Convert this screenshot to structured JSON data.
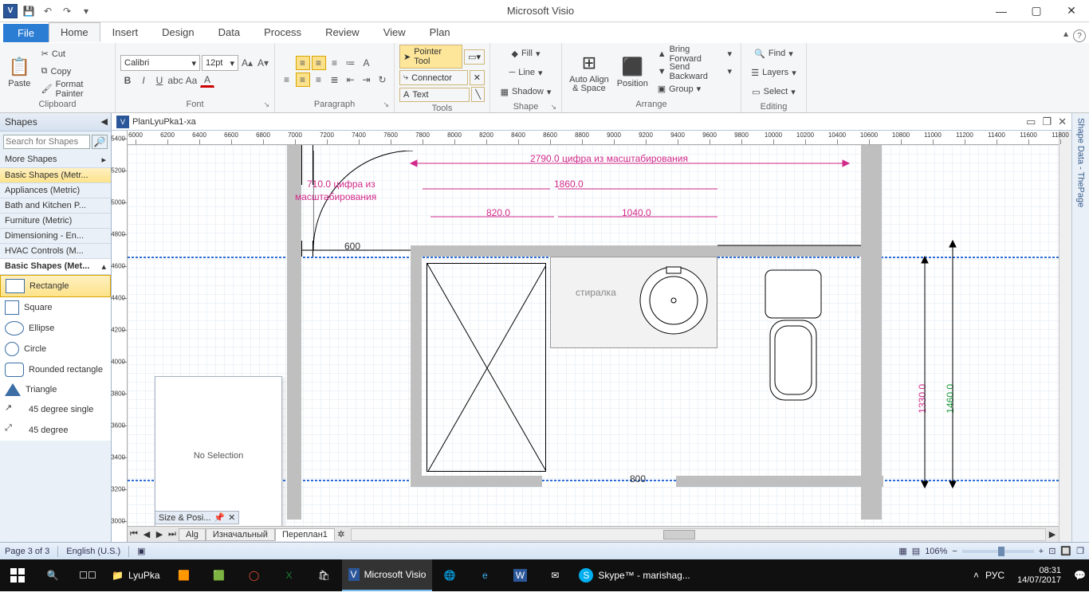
{
  "titlebar": {
    "app_title": "Microsoft Visio",
    "app_badge": "V"
  },
  "qat": {
    "save": "💾",
    "undo": "↶",
    "redo": "↷"
  },
  "tabs": {
    "file": "File",
    "home": "Home",
    "insert": "Insert",
    "design": "Design",
    "data": "Data",
    "process": "Process",
    "review": "Review",
    "view": "View",
    "plan": "Plan"
  },
  "ribbon": {
    "clipboard": {
      "label": "Clipboard",
      "paste": "Paste",
      "cut": "Cut",
      "copy": "Copy",
      "format_painter": "Format Painter"
    },
    "font": {
      "label": "Font",
      "name": "Calibri",
      "size": "12pt"
    },
    "paragraph": {
      "label": "Paragraph"
    },
    "tools": {
      "label": "Tools",
      "pointer": "Pointer Tool",
      "connector": "Connector",
      "text": "Text"
    },
    "shape": {
      "label": "Shape",
      "fill": "Fill",
      "line": "Line",
      "shadow": "Shadow"
    },
    "arrange": {
      "label": "Arrange",
      "autoalign": "Auto Align & Space",
      "position": "Position",
      "bring_forward": "Bring Forward",
      "send_backward": "Send Backward",
      "group": "Group"
    },
    "editing": {
      "label": "Editing",
      "find": "Find",
      "layers": "Layers",
      "select": "Select"
    }
  },
  "document": {
    "filename": "PlanLyuPka1-xa"
  },
  "shapes_panel": {
    "title": "Shapes",
    "search_placeholder": "Search for Shapes",
    "more_shapes": "More Shapes",
    "stencils": [
      "Basic Shapes (Metr...",
      "Appliances (Metric)",
      "Bath and Kitchen P...",
      "Furniture (Metric)",
      "Dimensioning - En...",
      "HVAC Controls (M..."
    ],
    "expanded_stencil": "Basic Shapes (Met...",
    "shape_items": [
      "Rectangle",
      "Square",
      "Ellipse",
      "Circle",
      "Rounded rectangle",
      "Triangle",
      "45 degree single",
      "45 degree"
    ]
  },
  "canvas": {
    "ruler_h": [
      "6000",
      "6200",
      "6400",
      "6600",
      "6800",
      "7000",
      "7200",
      "7400",
      "7600",
      "7800",
      "8000",
      "8200",
      "8400",
      "8600",
      "8800",
      "9000",
      "9200",
      "9400",
      "9600",
      "9800",
      "10000",
      "10200",
      "10400",
      "10600",
      "10800",
      "11000",
      "11200",
      "11400",
      "11600",
      "11800"
    ],
    "ruler_v": [
      "5400",
      "5200",
      "5000",
      "4800",
      "4600",
      "4400",
      "4200",
      "4000",
      "3800",
      "3600",
      "3400",
      "3200",
      "3000"
    ],
    "dims": {
      "d1": "2790.0 цифра из масштабирования",
      "d2_a": "710.0 цифра из",
      "d2_b": "масштабирования",
      "d3": "1860.0",
      "d4": "820.0",
      "d5": "1040.0",
      "d6": "600",
      "d7": "800",
      "v1": "1330.0",
      "v2": "1460.0"
    },
    "labels": {
      "washer": "стиралка"
    },
    "no_selection": "No Selection",
    "size_pos": "Size & Posi..."
  },
  "page_tabs": {
    "t1": "Alg",
    "t2": "Изначальный",
    "t3": "Переплан1"
  },
  "side_pane": {
    "label": "Shape Data - ThePage"
  },
  "status": {
    "page": "Page 3 of 3",
    "lang": "English (U.S.)",
    "zoom": "106%"
  },
  "taskbar": {
    "folder": "LyuPka",
    "visio": "Microsoft Visio",
    "skype": "Skype™ - marishag...",
    "lang": "РУС",
    "time": "08:31",
    "date": "14/07/2017"
  }
}
